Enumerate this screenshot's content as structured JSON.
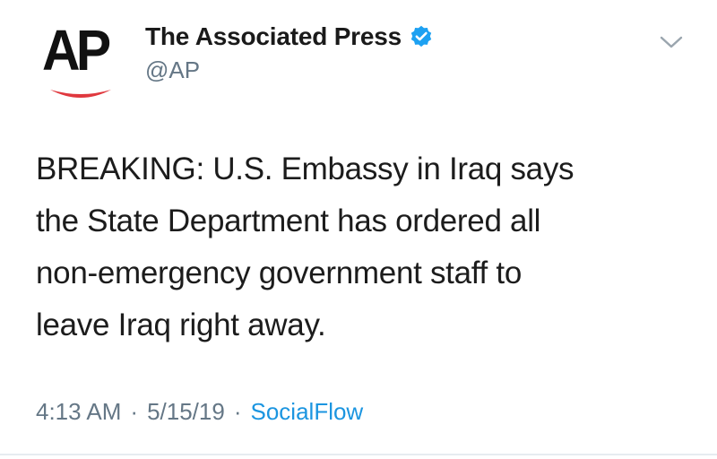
{
  "author": {
    "logo_text": "AP",
    "display_name": "The Associated Press",
    "handle": "@AP",
    "verified": true
  },
  "tweet": {
    "lines": [
      "BREAKING: U.S. Embassy in Iraq says",
      "the State Department has ordered all",
      "non-emergency government staff to",
      "leave Iraq right away."
    ]
  },
  "meta": {
    "time": "4:13 AM",
    "separator": "·",
    "date": "5/15/19",
    "source": "SocialFlow"
  },
  "icons": {
    "verified": "verified-badge-icon",
    "menu": "chevron-down-icon"
  },
  "colors": {
    "verified_blue": "#1da1f2",
    "link_blue": "#1b95e0",
    "muted_gray": "#657786",
    "ap_red": "#e0383e"
  }
}
